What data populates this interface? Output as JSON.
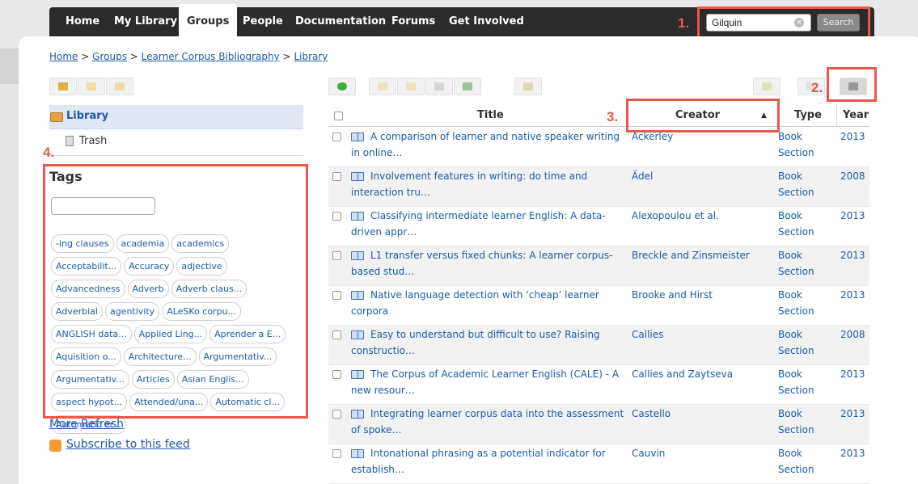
{
  "nav": {
    "items": [
      {
        "label": "Home"
      },
      {
        "label": "My Library"
      },
      {
        "label": "Groups"
      },
      {
        "label": "People"
      },
      {
        "label": "Documentation"
      },
      {
        "label": "Forums"
      },
      {
        "label": "Get Involved"
      }
    ],
    "active_index": 2
  },
  "search": {
    "value": "Gilquin",
    "button_label": "Search"
  },
  "breadcrumb": {
    "items": [
      "Home",
      "Groups",
      "Learner Corpus Bibliography",
      "Library"
    ],
    "separator": ">"
  },
  "callouts": {
    "one": "1.",
    "two": "2.",
    "three": "3.",
    "four": "4."
  },
  "sidebar": {
    "library_label": "Library",
    "trash_label": "Trash",
    "tags_title": "Tags",
    "tags": [
      "-ing clauses",
      "academia",
      "academics",
      "Acceptabilit...",
      "Accuracy",
      "adjective",
      "Advancedness",
      "Adverb",
      "Adverb claus...",
      "Adverbial",
      "agentivity",
      "ALeSKo corpu...",
      "ANGLISH data...",
      "Applied Ling...",
      "Aprender a E...",
      "Aquisition o...",
      "Architecture...",
      "Argumentativ...",
      "Argumentativ...",
      "Articles",
      "Asian Englis...",
      "aspect hypot...",
      "Attended/una...",
      "Automatic cl...",
      "Automatic er..."
    ],
    "more_label": "More",
    "refresh_label": "Refresh",
    "subscribe_label": "Subscribe to this feed"
  },
  "table": {
    "headers": {
      "title": "Title",
      "creator": "Creator",
      "type": "Type",
      "year": "Year"
    },
    "sort_indicator": "▲",
    "rows": [
      {
        "title": "A comparison of learner and native speaker writing in online…",
        "creator": "Ackerley",
        "type": "Book Section",
        "year": "2013"
      },
      {
        "title": "Involvement features in writing: do time and interaction tru…",
        "creator": "Ädel",
        "type": "Book Section",
        "year": "2008"
      },
      {
        "title": "Classifying intermediate learner English: A data-driven appr…",
        "creator": "Alexopoulou et al.",
        "type": "Book Section",
        "year": "2013"
      },
      {
        "title": "L1 transfer versus fixed chunks: A learner corpus-based stud…",
        "creator": "Breckle and Zinsmeister",
        "type": "Book Section",
        "year": "2013"
      },
      {
        "title": "Native language detection with ‘cheap’ learner corpora",
        "creator": "Brooke and Hirst",
        "type": "Book Section",
        "year": "2013"
      },
      {
        "title": "Easy to understand but difficult to use? Raising constructio…",
        "creator": "Callies",
        "type": "Book Section",
        "year": "2008"
      },
      {
        "title": "The Corpus of Academic Learner English (CALE) - A new resour…",
        "creator": "Callies and Zaytseva",
        "type": "Book Section",
        "year": "2013"
      },
      {
        "title": "Integrating learner corpus data into the assessment of spoke…",
        "creator": "Castello",
        "type": "Book Section",
        "year": "2013"
      },
      {
        "title": "Intonational phrasing as a potential indicator for establish…",
        "creator": "Cauvin",
        "type": "Book Section",
        "year": "2013"
      }
    ]
  },
  "colors": {
    "link": "#1d5ba8",
    "callout": "#e8584c",
    "nav_bg": "#2b2b2b"
  }
}
